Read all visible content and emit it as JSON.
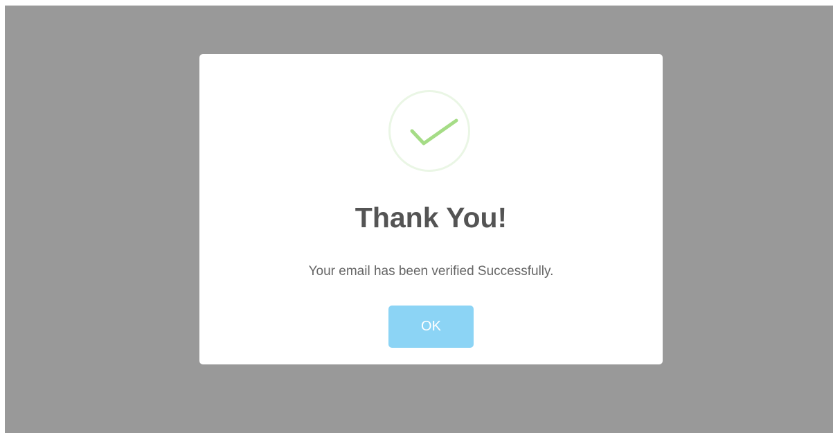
{
  "dialog": {
    "icon": "checkmark-icon",
    "title": "Thank You!",
    "message": "Your email has been verified Successfully.",
    "ok_label": "OK"
  },
  "colors": {
    "overlay": "#999999",
    "modal_background": "#ffffff",
    "success_ring": "#eaf6e5",
    "checkmark": "#a5dc86",
    "title": "#545454",
    "message": "#666666",
    "ok_button": "#8cd4f5",
    "ok_text": "#ffffff"
  }
}
